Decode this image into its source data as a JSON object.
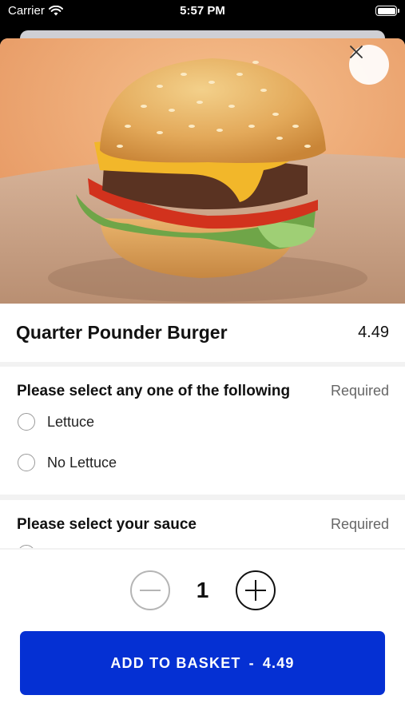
{
  "status_bar": {
    "carrier": "Carrier",
    "time": "5:57 PM"
  },
  "item": {
    "name": "Quarter Pounder Burger",
    "price": "4.49",
    "image": "burger-photo"
  },
  "sections": [
    {
      "question": "Please select any one of the following",
      "requirement": "Required",
      "options": [
        "Lettuce",
        "No Lettuce"
      ]
    },
    {
      "question": "Please select your sauce",
      "requirement": "Required",
      "options": []
    }
  ],
  "quantity": {
    "value": "1",
    "minus_icon": "minus-circle-icon",
    "plus_icon": "plus-circle-icon"
  },
  "add_button": {
    "label": "ADD TO BASKET",
    "separator": "-",
    "price": "4.49",
    "color": "#0530d3"
  },
  "icons": {
    "close": "close-icon",
    "wifi": "wifi-icon",
    "battery": "battery-icon"
  }
}
